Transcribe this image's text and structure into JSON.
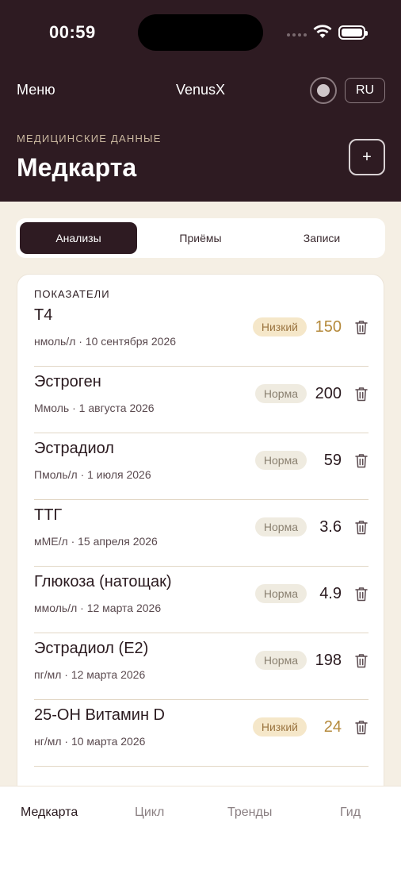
{
  "status_bar": {
    "time": "00:59"
  },
  "top_bar": {
    "menu_label": "Меню",
    "app_title": "VenusX",
    "lang_label": "RU"
  },
  "header": {
    "section_label": "МЕДИЦИНСКИЕ ДАННЫЕ",
    "page_title": "Медкарта",
    "add_label": "+"
  },
  "tabs": [
    {
      "label": "Анализы",
      "active": true
    },
    {
      "label": "Приёмы",
      "active": false
    },
    {
      "label": "Записи",
      "active": false
    }
  ],
  "card": {
    "label": "ПОКАЗАТЕЛИ",
    "rows": [
      {
        "name": "T4",
        "meta": "нмоль/л · 10 сентября 2026",
        "status": "Низкий",
        "status_kind": "low",
        "value": "150"
      },
      {
        "name": "Эстроген",
        "meta": "Ммоль · 1 августа 2026",
        "status": "Норма",
        "status_kind": "normal",
        "value": "200"
      },
      {
        "name": "Эстрадиол",
        "meta": "Пмоль/л · 1 июля 2026",
        "status": "Норма",
        "status_kind": "normal",
        "value": "59"
      },
      {
        "name": "ТТГ",
        "meta": "мМЕ/л · 15 апреля 2026",
        "status": "Норма",
        "status_kind": "normal",
        "value": "3.6"
      },
      {
        "name": "Глюкоза (натощак)",
        "meta": "ммоль/л · 12 марта 2026",
        "status": "Норма",
        "status_kind": "normal",
        "value": "4.9"
      },
      {
        "name": "Эстрадиол (E2)",
        "meta": "пг/мл · 12 марта 2026",
        "status": "Норма",
        "status_kind": "normal",
        "value": "198"
      },
      {
        "name": "25-OH Витамин D",
        "meta": "нг/мл · 10 марта 2026",
        "status": "Низкий",
        "status_kind": "low",
        "value": "24"
      }
    ]
  },
  "bottom_nav": [
    {
      "label": "Медкарта",
      "active": true
    },
    {
      "label": "Цикл",
      "active": false
    },
    {
      "label": "Тренды",
      "active": false
    },
    {
      "label": "Гид",
      "active": false
    }
  ],
  "colors": {
    "header_bg": "#2e1b22",
    "page_bg": "#f5efe4",
    "low_accent": "#b58a3c",
    "normal_badge": "#efebe0"
  },
  "icons": {
    "delete": "trash-icon",
    "theme": "toggle-dot-icon",
    "wifi": "wifi-icon",
    "battery": "battery-icon"
  }
}
